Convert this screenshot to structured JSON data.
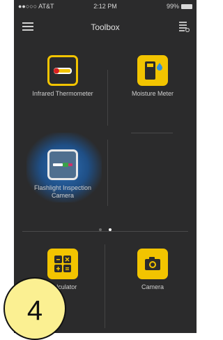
{
  "statusbar": {
    "carrier": "●●○○○ AT&T",
    "time": "2:12 PM",
    "battery": "99%"
  },
  "header": {
    "title": "Toolbox"
  },
  "tools": [
    {
      "label": "Infrared Thermometer"
    },
    {
      "label": "Moisture Meter"
    },
    {
      "label": "Flashlight Inspection Camera"
    },
    {
      "label": "Calculator"
    },
    {
      "label": "Camera"
    }
  ],
  "pager": {
    "pages": 2,
    "current": 2
  },
  "badge": {
    "number": "4"
  },
  "colors": {
    "accent": "#f2c400",
    "background": "#2b2b2c",
    "highlight": "#2e6fb5"
  }
}
